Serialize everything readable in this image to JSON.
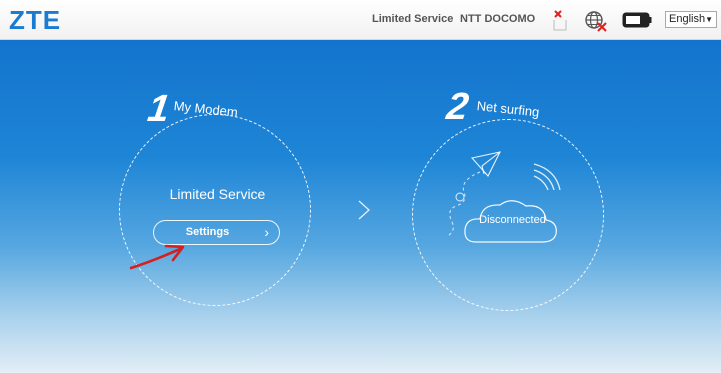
{
  "header": {
    "logo": "ZTE",
    "service_status": "Limited Service",
    "carrier": "NTT DOCOMO",
    "sim_icon": "sim-missing-icon",
    "network_icon": "globe-disconnected-icon",
    "battery_icon": "battery-icon",
    "language": {
      "selected": "English",
      "arrow": "▼"
    }
  },
  "step1": {
    "number": "1",
    "title": "My Modem",
    "status": "Limited Service",
    "button_label": "Settings",
    "button_chevron": "›"
  },
  "step2": {
    "number": "2",
    "title": "Net surfing",
    "status": "Disconnected"
  },
  "colors": {
    "brand": "#1a7bd1",
    "gradient_top": "#1374cd",
    "gradient_bottom": "#e3eef6",
    "annotation_arrow": "#d42020"
  }
}
